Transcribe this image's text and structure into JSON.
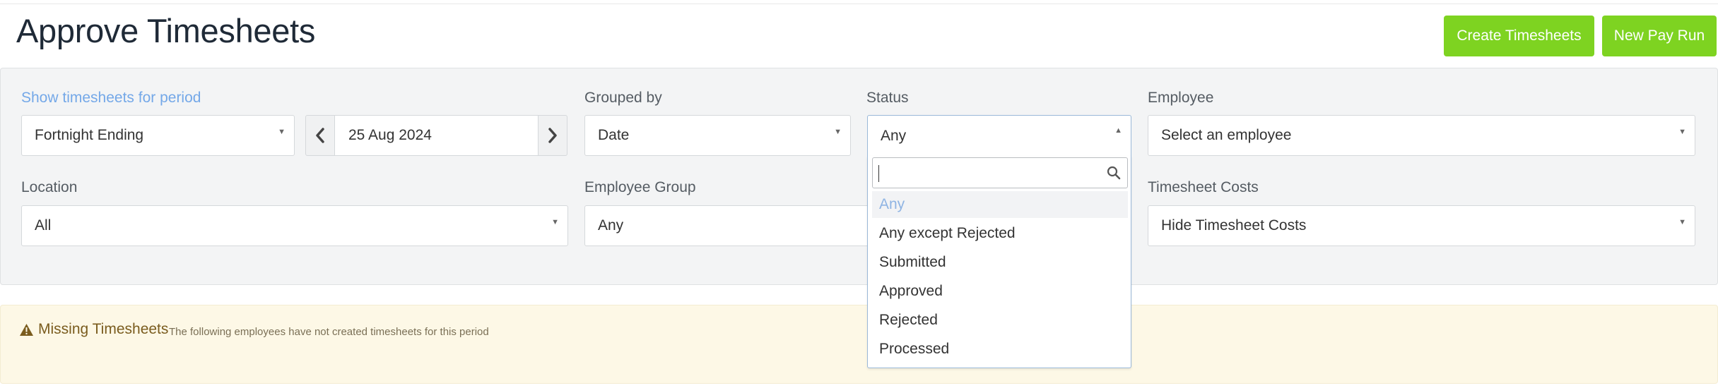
{
  "header": {
    "title": "Approve Timesheets",
    "create_button": "Create Timesheets",
    "payrun_button": "New Pay Run"
  },
  "filters": {
    "period_label": "Show timesheets for period",
    "period_value": "Fortnight Ending",
    "date_value": "25 Aug 2024",
    "grouped_label": "Grouped by",
    "grouped_value": "Date",
    "status_label": "Status",
    "status_value": "Any",
    "employee_label": "Employee",
    "employee_placeholder": "Select an employee",
    "location_label": "Location",
    "location_value": "All",
    "group_label": "Employee Group",
    "group_value": "Any",
    "costs_label": "Timesheet Costs",
    "costs_value": "Hide Timesheet Costs"
  },
  "status_dropdown": {
    "search_value": "",
    "options": [
      "Any",
      "Any except Rejected",
      "Submitted",
      "Approved",
      "Rejected",
      "Processed"
    ],
    "highlighted": "Any"
  },
  "alert": {
    "title": "Missing Timesheets",
    "message": "The following employees have not created timesheets for this period"
  },
  "colors": {
    "accent_green": "#7ed321",
    "link_blue": "#74a8e8",
    "alert_bg": "#fdf8e6",
    "alert_text": "#7a5c1e"
  },
  "icons": {
    "prev": "chevron-left-icon",
    "next": "chevron-right-icon",
    "search": "search-icon",
    "warning": "warning-icon",
    "caret": "caret-down-icon"
  }
}
